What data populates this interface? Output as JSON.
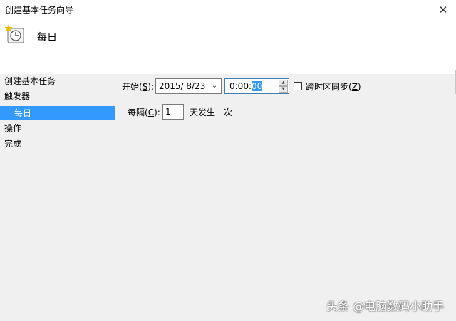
{
  "window": {
    "title": "创建基本任务向导",
    "close_glyph": "✕",
    "header_title": "每日",
    "header_icon": "clock-icon"
  },
  "sidebar": {
    "items": [
      {
        "label": "创建基本任务",
        "selected": false
      },
      {
        "label": "触发器",
        "selected": false
      },
      {
        "label": "每日",
        "selected": true
      },
      {
        "label": "操作",
        "selected": false
      },
      {
        "label": "完成",
        "selected": false
      }
    ]
  },
  "form": {
    "start_label": "开始(",
    "start_key": "S",
    "start_suffix": "):",
    "date_value": "2015/  8/23",
    "time_prefix": "0:00:",
    "time_selected": "00",
    "sync_label_prefix": "跨时区同步(",
    "sync_key": "Z",
    "sync_label_suffix": ")",
    "recur_label": "每隔(",
    "recur_key": "C",
    "recur_suffix": "):",
    "recur_value": "1",
    "recur_unit": "天发生一次"
  },
  "watermark": {
    "text": "头条 @电脑数码小助手"
  }
}
